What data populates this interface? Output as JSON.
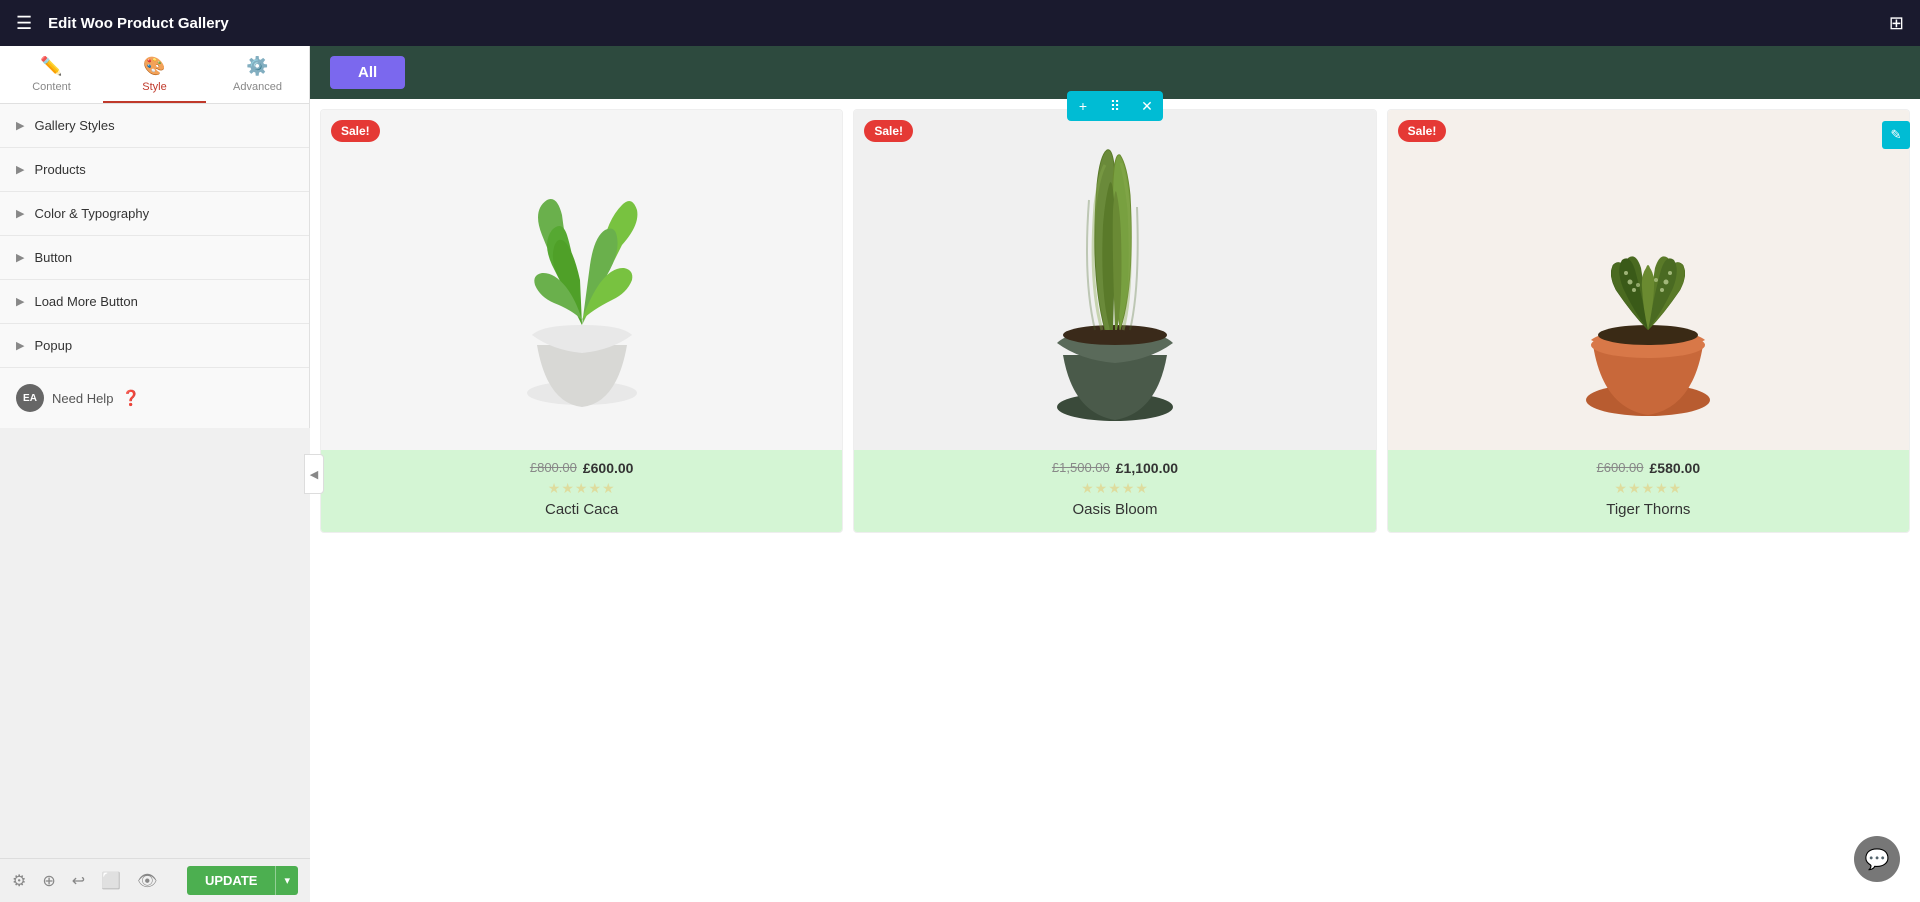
{
  "topbar": {
    "title": "Edit Woo Product Gallery",
    "hamburger_icon": "☰",
    "grid_icon": "⊞"
  },
  "sidebar": {
    "tabs": [
      {
        "id": "content",
        "label": "Content",
        "icon": "✏️",
        "active": false
      },
      {
        "id": "style",
        "label": "Style",
        "icon": "🎨",
        "active": true
      },
      {
        "id": "advanced",
        "label": "Advanced",
        "icon": "⚙️",
        "active": false
      }
    ],
    "accordion_items": [
      {
        "id": "gallery-styles",
        "label": "Gallery Styles"
      },
      {
        "id": "products",
        "label": "Products"
      },
      {
        "id": "color-typography",
        "label": "Color & Typography"
      },
      {
        "id": "button",
        "label": "Button"
      },
      {
        "id": "load-more-button",
        "label": "Load More Button"
      },
      {
        "id": "popup",
        "label": "Popup"
      }
    ],
    "footer": {
      "logo": "EA",
      "help_label": "Need Help",
      "help_icon": "?"
    }
  },
  "bottom_bar": {
    "icons": [
      "⚙",
      "⊕",
      "↩",
      "⬜",
      "👁"
    ],
    "update_label": "UPDATE",
    "update_arrow": "▾"
  },
  "toolbar": {
    "add_icon": "+",
    "move_icon": "⠿",
    "close_icon": "✕"
  },
  "filter_bar": {
    "all_label": "All"
  },
  "products": [
    {
      "id": "cacti-caca",
      "name": "Cacti Caca",
      "sale": true,
      "sale_label": "Sale!",
      "price_old": "£800.00",
      "price_new": "£600.00",
      "stars": 0,
      "total_stars": 5,
      "image_alt": "Cacti Caca plant in white pot"
    },
    {
      "id": "oasis-bloom",
      "name": "Oasis Bloom",
      "sale": true,
      "sale_label": "Sale!",
      "price_old": "£1,500.00",
      "price_new": "£1,100.00",
      "stars": 0,
      "total_stars": 5,
      "image_alt": "Oasis Bloom plant in dark pot"
    },
    {
      "id": "tiger-thorns",
      "name": "Tiger Thorns",
      "sale": true,
      "sale_label": "Sale!",
      "price_old": "£600.00",
      "price_new": "£580.00",
      "stars": 0,
      "total_stars": 5,
      "image_alt": "Tiger Thorns plant in terracotta pot"
    }
  ],
  "colors": {
    "topbar_bg": "#1a1a2e",
    "sidebar_bg": "#f9f9f9",
    "active_tab_color": "#c0392b",
    "filter_bg": "#2d4a3e",
    "filter_btn_bg": "#7b68ee",
    "sale_badge_bg": "#e53935",
    "product_info_bg": "#d4f5d4",
    "toolbar_bg": "#00bcd4",
    "update_btn_bg": "#4CAF50",
    "star_color": "#f5a623"
  }
}
